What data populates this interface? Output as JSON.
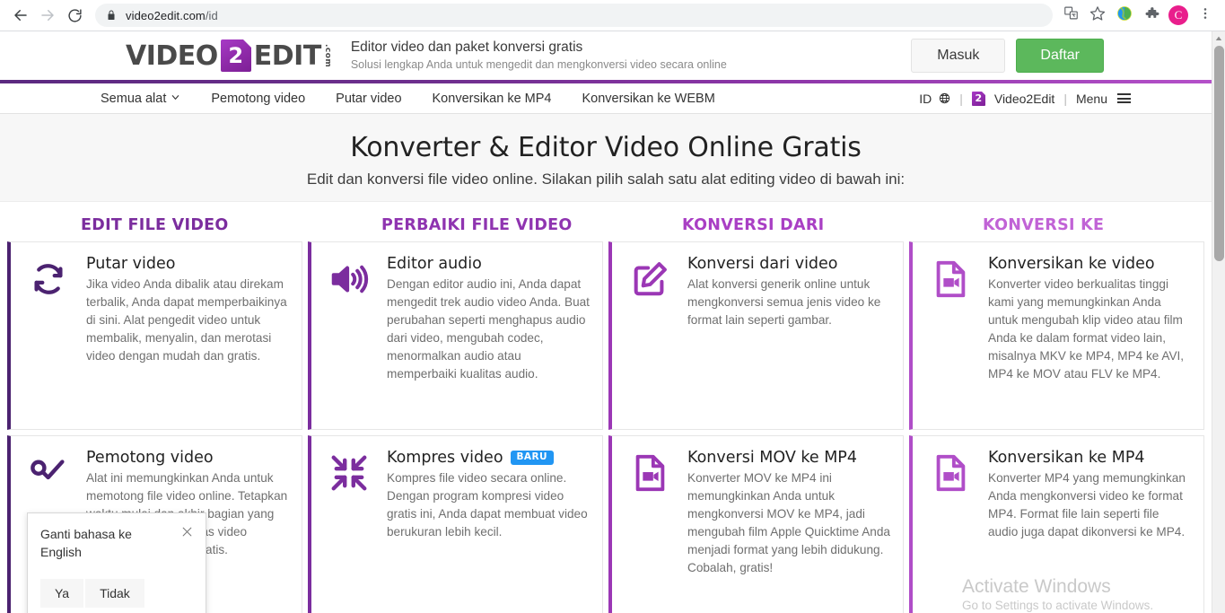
{
  "browser": {
    "back_icon": "back-arrow-icon",
    "forward_icon": "forward-arrow-icon",
    "reload_icon": "reload-icon",
    "lock_icon": "lock-icon",
    "url_domain": "video2edit.com",
    "url_path": "/id",
    "translate_icon": "translate-icon",
    "bookmark_icon": "star-icon",
    "extension_globe_icon": "globe-extension-icon",
    "extensions_icon": "puzzle-piece-icon",
    "profile_initial": "C",
    "menu_icon": "three-dot-menu-icon"
  },
  "header": {
    "logo": {
      "word1": "VIDEO",
      "mark": "2",
      "word2": "EDIT",
      "suffix": ".com"
    },
    "tagline_main": "Editor video dan paket konversi gratis",
    "tagline_sub": "Solusi lengkap Anda untuk mengedit dan mengkonversi video secara online",
    "login_label": "Masuk",
    "signup_label": "Daftar"
  },
  "nav": {
    "items": [
      {
        "label": "Semua alat",
        "has_caret": true
      },
      {
        "label": "Pemotong video",
        "has_caret": false
      },
      {
        "label": "Putar video",
        "has_caret": false
      },
      {
        "label": "Konversikan ke MP4",
        "has_caret": false
      },
      {
        "label": "Konversikan ke WEBM",
        "has_caret": false
      }
    ],
    "lang_code": "ID",
    "divider": "|",
    "brand_label": "Video2Edit",
    "brand_mark": "2",
    "menu_label": "Menu"
  },
  "hero": {
    "title": "Konverter & Editor Video Online Gratis",
    "subtitle": "Edit dan konversi file video online. Silakan pilih salah satu alat editing video di bawah ini:"
  },
  "columns": [
    {
      "title": "EDIT FILE VIDEO",
      "color": "#7b2d9e"
    },
    {
      "title": "PERBAIKI FILE VIDEO",
      "color": "#8f34b0"
    },
    {
      "title": "KONVERSI DARI",
      "color": "#a93fc4"
    },
    {
      "title": "KONVERSI KE",
      "color": "#c163d6"
    }
  ],
  "cards": [
    {
      "title": "Putar video",
      "icon": "rotate-arrows-icon",
      "badge": null,
      "desc": "Jika video Anda dibalik atau direkam terbalik, Anda dapat memperbaikinya di sini. Alat pengedit video untuk membalik, menyalin, dan merotasi video dengan mudah dan gratis.",
      "border": "#4b2270"
    },
    {
      "title": "Editor audio",
      "icon": "speaker-sound-icon",
      "badge": null,
      "desc": "Dengan editor audio ini, Anda dapat mengedit trek audio video Anda. Buat perubahan seperti menghapus audio dari video, mengubah codec, menormalkan audio atau memperbaiki kualitas audio.",
      "border": "#7b2d9e"
    },
    {
      "title": "Konversi dari video",
      "icon": "pencil-edit-square-icon",
      "badge": null,
      "desc": "Alat konversi generik online untuk mengkonversi semua jenis video ke format lain seperti gambar.",
      "border": "#9b37b5"
    },
    {
      "title": "Konversikan ke video",
      "icon": "video-file-icon",
      "badge": null,
      "desc": "Konverter video berkualitas tinggi kami yang memungkinkan Anda untuk mengubah klip video atau film Anda ke dalam format video lain, misalnya MKV ke MP4, MP4 ke AVI, MP4 ke MOV atau FLV ke MP4.",
      "border": "#b04ec8"
    },
    {
      "title": "Pemotong video",
      "icon": "cut-check-icon",
      "badge": null,
      "desc": "Alat ini memungkinkan Anda untuk memotong file video online. Tetapkan waktu mulai dan akhir bagian yang diinginkan dan pangkas video dengan mudah dan gratis.",
      "border": "#4b2270"
    },
    {
      "title": "Kompres video",
      "icon": "compress-arrows-icon",
      "badge": "BARU",
      "desc": "Kompres file video secara online. Dengan program kompresi video gratis ini, Anda dapat membuat video berukuran lebih kecil.",
      "border": "#7b2d9e"
    },
    {
      "title": "Konversi MOV ke MP4",
      "icon": "video-file-icon",
      "badge": null,
      "desc": "Konverter MOV ke MP4 ini memungkinkan Anda untuk mengkonversi MOV ke MP4, jadi mengubah film Apple Quicktime Anda menjadi format yang lebih didukung. Cobalah, gratis!",
      "border": "#9b37b5"
    },
    {
      "title": "Konversikan ke MP4",
      "icon": "video-file-icon",
      "badge": null,
      "desc": "Konverter MP4 yang memungkinkan Anda mengkonversi video ke format MP4. Format file lain seperti file audio juga dapat dikonversi ke MP4.",
      "border": "#b04ec8"
    }
  ],
  "language_popup": {
    "message": "Ganti bahasa ke English",
    "close_icon": "close-x-icon",
    "yes_label": "Ya",
    "no_label": "Tidak"
  },
  "watermark": {
    "title": "Activate Windows",
    "subtitle": "Go to Settings to activate Windows."
  }
}
